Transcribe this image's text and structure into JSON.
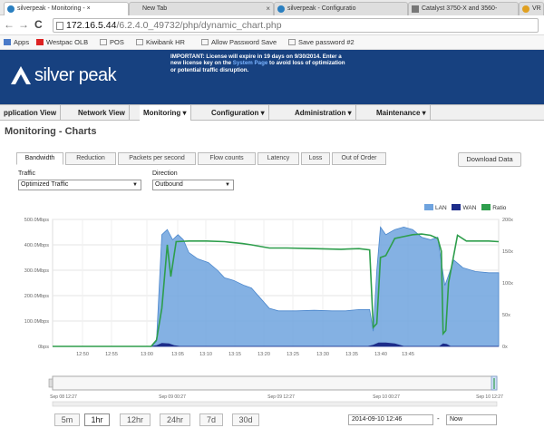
{
  "browser": {
    "tabs": [
      {
        "label": "silverpeak - Monitoring - ×",
        "active": true
      },
      {
        "label": "New Tab",
        "active": false
      },
      {
        "label": "silverpeak - Configuratio",
        "active": false
      },
      {
        "label": "Catalyst 3750-X and 3560-",
        "active": false
      },
      {
        "label": "VR",
        "active": false
      }
    ],
    "url_host": "172.16.5.44",
    "url_path": "/6.2.4.0_49732/php/dynamic_chart.php",
    "bookmarks": [
      "Apps",
      "Westpac OLB",
      "POS",
      "Kiwibank HR",
      "Allow Password Save",
      "Save password #2"
    ]
  },
  "header": {
    "logo": "silver peak",
    "notice_bold": "IMPORTANT: License will expire in 19 days on 9/30/2014. Enter a new license key on the ",
    "notice_link": "System Page",
    "notice_tail": " to avoid loss of optimization or potential traffic disruption."
  },
  "menu": [
    {
      "label": "pplication View",
      "active": false
    },
    {
      "label": "Network View",
      "active": false
    },
    {
      "label": "Monitoring ▾",
      "active": true
    },
    {
      "label": "Configuration ▾",
      "active": false
    },
    {
      "label": "Administration ▾",
      "active": false
    },
    {
      "label": "Maintenance ▾",
      "active": false
    }
  ],
  "page_title": "Monitoring - Charts",
  "chart_tabs": [
    "Bandwidth",
    "Reduction",
    "Packets per second",
    "Flow counts",
    "Latency",
    "Loss",
    "Out of Order"
  ],
  "active_chart_tab": "Bandwidth",
  "download_label": "Download Data",
  "filters": {
    "traffic_label": "Traffic",
    "traffic_value": "Optimized Traffic",
    "direction_label": "Direction",
    "direction_value": "Outbound"
  },
  "colors": {
    "lan": "#6fa3de",
    "wan": "#1d2d8a",
    "ratio": "#2e9e4c",
    "header": "#174180"
  },
  "chart_data": {
    "type": "area",
    "x": [
      "12:50",
      "12:55",
      "13:00",
      "13:05",
      "13:10",
      "13:15",
      "13:20",
      "13:25",
      "13:30",
      "13:35",
      "13:40",
      "13:45"
    ],
    "series": [
      {
        "name": "LAN",
        "axis": "left",
        "unit": "Mbps",
        "points": [
          [
            48,
            0
          ],
          [
            120,
            0
          ],
          [
            158,
            0
          ],
          [
            164,
            20
          ],
          [
            170,
            440
          ],
          [
            176,
            460
          ],
          [
            182,
            420
          ],
          [
            188,
            440
          ],
          [
            194,
            420
          ],
          [
            200,
            370
          ],
          [
            210,
            345
          ],
          [
            222,
            330
          ],
          [
            232,
            300
          ],
          [
            240,
            270
          ],
          [
            250,
            260
          ],
          [
            262,
            240
          ],
          [
            270,
            230
          ],
          [
            280,
            190
          ],
          [
            290,
            150
          ],
          [
            300,
            140
          ],
          [
            320,
            140
          ],
          [
            340,
            142
          ],
          [
            360,
            140
          ],
          [
            375,
            140
          ],
          [
            390,
            145
          ],
          [
            402,
            145
          ],
          [
            406,
            60
          ],
          [
            410,
            300
          ],
          [
            414,
            470
          ],
          [
            420,
            440
          ],
          [
            430,
            460
          ],
          [
            440,
            470
          ],
          [
            450,
            460
          ],
          [
            460,
            430
          ],
          [
            470,
            420
          ],
          [
            478,
            430
          ],
          [
            482,
            330
          ],
          [
            486,
            240
          ],
          [
            490,
            280
          ],
          [
            496,
            340
          ],
          [
            506,
            310
          ],
          [
            520,
            295
          ],
          [
            535,
            290
          ],
          [
            546,
            290
          ]
        ]
      },
      {
        "name": "WAN",
        "axis": "left",
        "unit": "Mbps",
        "points": [
          [
            48,
            0
          ],
          [
            158,
            0
          ],
          [
            164,
            3
          ],
          [
            170,
            12
          ],
          [
            178,
            10
          ],
          [
            184,
            3
          ],
          [
            190,
            0
          ],
          [
            400,
            0
          ],
          [
            406,
            5
          ],
          [
            412,
            14
          ],
          [
            420,
            14
          ],
          [
            430,
            10
          ],
          [
            440,
            0
          ],
          [
            480,
            0
          ],
          [
            484,
            10
          ],
          [
            488,
            8
          ],
          [
            492,
            0
          ],
          [
            546,
            0
          ]
        ]
      },
      {
        "name": "Ratio",
        "axis": "right",
        "unit": "",
        "points": [
          [
            48,
            0
          ],
          [
            158,
            0
          ],
          [
            164,
            10
          ],
          [
            170,
            60
          ],
          [
            176,
            160
          ],
          [
            180,
            110
          ],
          [
            186,
            165
          ],
          [
            200,
            166
          ],
          [
            220,
            166
          ],
          [
            240,
            165
          ],
          [
            260,
            162
          ],
          [
            270,
            160
          ],
          [
            290,
            155
          ],
          [
            310,
            155
          ],
          [
            340,
            154
          ],
          [
            370,
            153
          ],
          [
            390,
            154
          ],
          [
            402,
            152
          ],
          [
            406,
            30
          ],
          [
            410,
            36
          ],
          [
            414,
            140
          ],
          [
            420,
            143
          ],
          [
            430,
            170
          ],
          [
            440,
            173
          ],
          [
            450,
            176
          ],
          [
            460,
            177
          ],
          [
            470,
            175
          ],
          [
            478,
            170
          ],
          [
            482,
            150
          ],
          [
            484,
            20
          ],
          [
            487,
            25
          ],
          [
            490,
            100
          ],
          [
            500,
            175
          ],
          [
            510,
            166
          ],
          [
            520,
            166
          ],
          [
            535,
            166
          ],
          [
            546,
            165
          ]
        ]
      }
    ],
    "y_left_ticks": [
      "0bps",
      "100.0Mbps",
      "200.0Mbps",
      "300.0Mbps",
      "400.0Mbps",
      "500.0Mbps"
    ],
    "y_left_max": 500,
    "y_right_ticks": [
      "0x",
      "50x",
      "100x",
      "150x",
      "200x"
    ],
    "y_right_max": 200,
    "legend": [
      "LAN",
      "WAN",
      "Ratio"
    ],
    "legend_position": "top-right",
    "grid": true,
    "overview_ticks": [
      "Sep 08 12:27",
      "Sep 09 00:27",
      "Sep 09 12:27",
      "Sep 10 00:27",
      "Sep 10 12:27"
    ]
  },
  "range_buttons": [
    "5m",
    "1hr",
    "12hr",
    "24hr",
    "7d",
    "30d"
  ],
  "active_range": "1hr",
  "date_from": "2014-09-10 12:46",
  "date_to": "Now"
}
